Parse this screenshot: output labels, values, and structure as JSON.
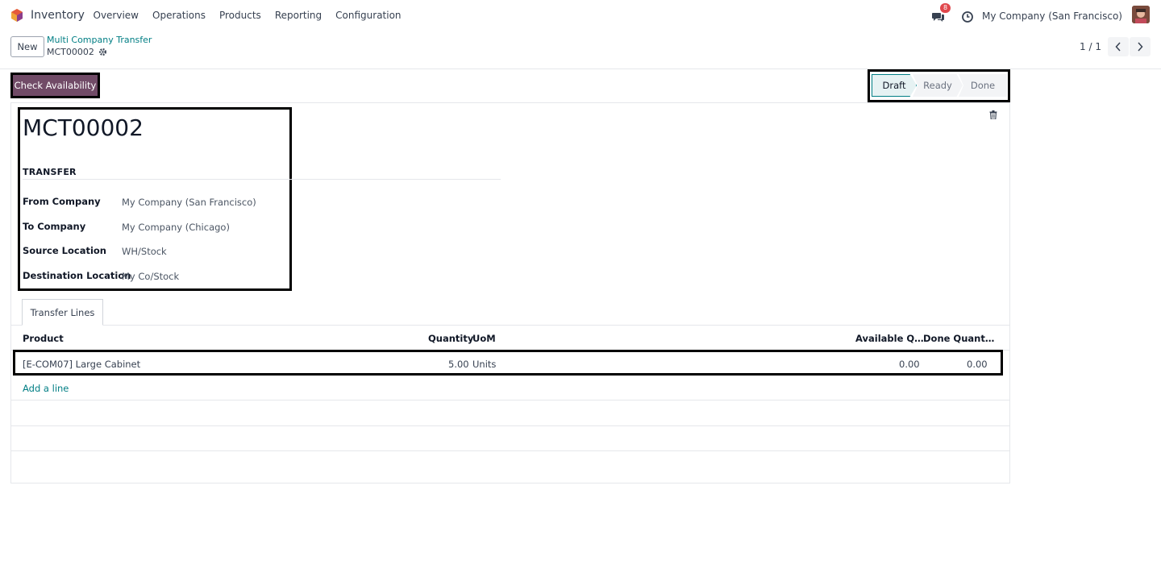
{
  "navbar": {
    "app_name": "Inventory",
    "menu": [
      "Overview",
      "Operations",
      "Products",
      "Reporting",
      "Configuration"
    ],
    "chat_badge": "8",
    "company": "My Company (San Francisco)"
  },
  "control_panel": {
    "new_label": "New",
    "breadcrumb_parent": "Multi Company Transfer",
    "breadcrumb_current": "MCT00002",
    "pager": "1 / 1"
  },
  "statusbar": {
    "action_label": "Check Availability",
    "stages": [
      "Draft",
      "Ready",
      "Done"
    ],
    "active_stage": "Draft"
  },
  "form": {
    "title": "MCT00002",
    "group_title": "TRANSFER",
    "fields": [
      {
        "label": "From Company",
        "value": "My Company (San Francisco)"
      },
      {
        "label": "To Company",
        "value": "My Company (Chicago)"
      },
      {
        "label": "Source Location",
        "value": "WH/Stock"
      },
      {
        "label": "Destination Location",
        "value": "My Co/Stock"
      }
    ]
  },
  "tabs": {
    "active": "Transfer Lines"
  },
  "lines_table": {
    "headers": {
      "product": "Product",
      "quantity": "Quantity",
      "uom": "UoM",
      "available": "Available Q…",
      "done": "Done Quant…"
    },
    "rows": [
      {
        "product": "[E-COM07] Large Cabinet",
        "quantity": "5.00",
        "uom": "Units",
        "available": "0.00",
        "done": "0.00"
      }
    ],
    "add_line": "Add a line"
  },
  "colors": {
    "brand": "#714b67",
    "link": "#017e84",
    "badge": "#e0474c"
  }
}
